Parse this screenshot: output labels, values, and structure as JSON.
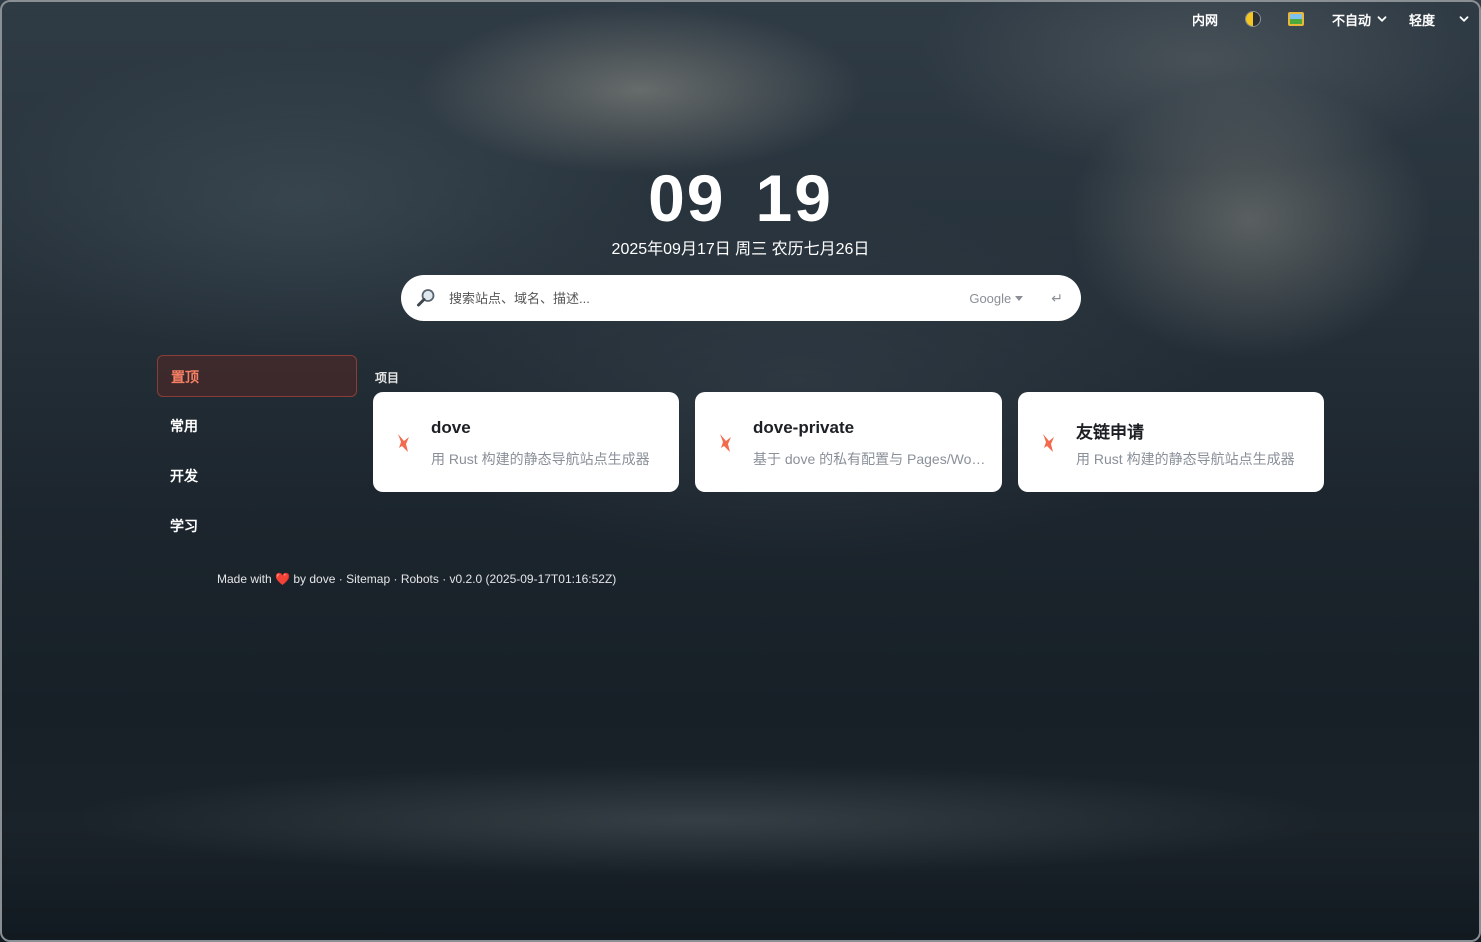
{
  "topbar": {
    "intranet_label": "内网",
    "theme_icon": "half-moon-icon",
    "wallpaper_icon": "picture-icon",
    "auto_select_value": "不自动",
    "mode_select_value": "轻度"
  },
  "clock": {
    "hours": "09",
    "minutes": "19"
  },
  "date_line": "2025年09月17日 周三 农历七月26日",
  "search": {
    "placeholder": "搜索站点、域名、描述...",
    "engine": "Google",
    "enter_symbol": "↵"
  },
  "sidebar": {
    "items": [
      {
        "label": "置顶",
        "active": true
      },
      {
        "label": "常用",
        "active": false
      },
      {
        "label": "开发",
        "active": false
      },
      {
        "label": "学习",
        "active": false
      }
    ]
  },
  "section": {
    "title": "项目",
    "cards": [
      {
        "title": "dove",
        "desc": "用 Rust 构建的静态导航站点生成器",
        "icon": "dove-logo-icon"
      },
      {
        "title": "dove-private",
        "desc": "基于 dove 的私有配置与 Pages/Workers 部署",
        "icon": "dove-logo-icon"
      },
      {
        "title": "友链申请",
        "desc": "用 Rust 构建的静态导航站点生成器",
        "icon": "dove-logo-icon"
      }
    ]
  },
  "footer": {
    "made_with": "Made with",
    "heart": "❤️",
    "by": "by",
    "author": "dove",
    "sep": "·",
    "sitemap": "Sitemap",
    "robots": "Robots",
    "version": "v0.2.0 (2025-09-17T01:16:52Z)"
  },
  "colors": {
    "accent": "#f47f63",
    "card_bg": "#ffffff",
    "logo": "#f26b4f"
  }
}
